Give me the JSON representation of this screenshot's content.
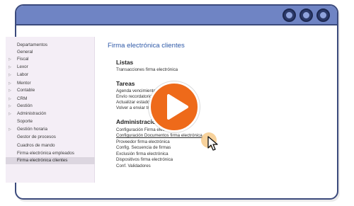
{
  "window": {
    "buttons": [
      "circle",
      "circle",
      "circle"
    ],
    "colors": {
      "titlebar": "#6f84c4",
      "border": "#3b4a7c",
      "play": "#ee6a1a"
    }
  },
  "sidebar": {
    "items": [
      {
        "label": "Departamentos",
        "arrow": false
      },
      {
        "label": "General",
        "arrow": false
      },
      {
        "label": "Fiscal",
        "arrow": true
      },
      {
        "label": "Lexor",
        "arrow": true
      },
      {
        "label": "Labor",
        "arrow": true
      },
      {
        "label": "Mentor",
        "arrow": true
      },
      {
        "label": "Contable",
        "arrow": true
      },
      {
        "label": "CRM",
        "arrow": true
      },
      {
        "label": "Gestión",
        "arrow": true
      },
      {
        "label": "Administración",
        "arrow": true
      },
      {
        "label": "Soporte",
        "arrow": false
      },
      {
        "label": "Gestión horaria",
        "arrow": true
      },
      {
        "label": "Gestor de procesos",
        "arrow": false
      },
      {
        "label": "Cuadros de mando",
        "arrow": false
      },
      {
        "label": "Firma electrónica empleados",
        "arrow": false
      },
      {
        "label": "Firma electrónica clientes",
        "arrow": false,
        "active": true
      }
    ]
  },
  "main": {
    "title": "Firma electrónica clientes",
    "sections": [
      {
        "heading": "Listas",
        "links": [
          "Transacciones firma electrónica"
        ]
      },
      {
        "heading": "Tareas",
        "links": [
          "Agenda vencimientos firmas",
          "Envío recordatorios firma pendiente",
          "Actualizar estado transacciones",
          "Volver a enviar transacciones"
        ]
      },
      {
        "heading": "Administración",
        "links": [
          "Configuración Firma electrónica",
          "Configuración Documentos firma electrónica",
          "Proveedor firma electrónica",
          "Config. Secuencia de firmas",
          "Exclusión firma electrónica",
          "Dispositivos firma electrónica",
          "Conf. Validadores"
        ]
      }
    ]
  }
}
